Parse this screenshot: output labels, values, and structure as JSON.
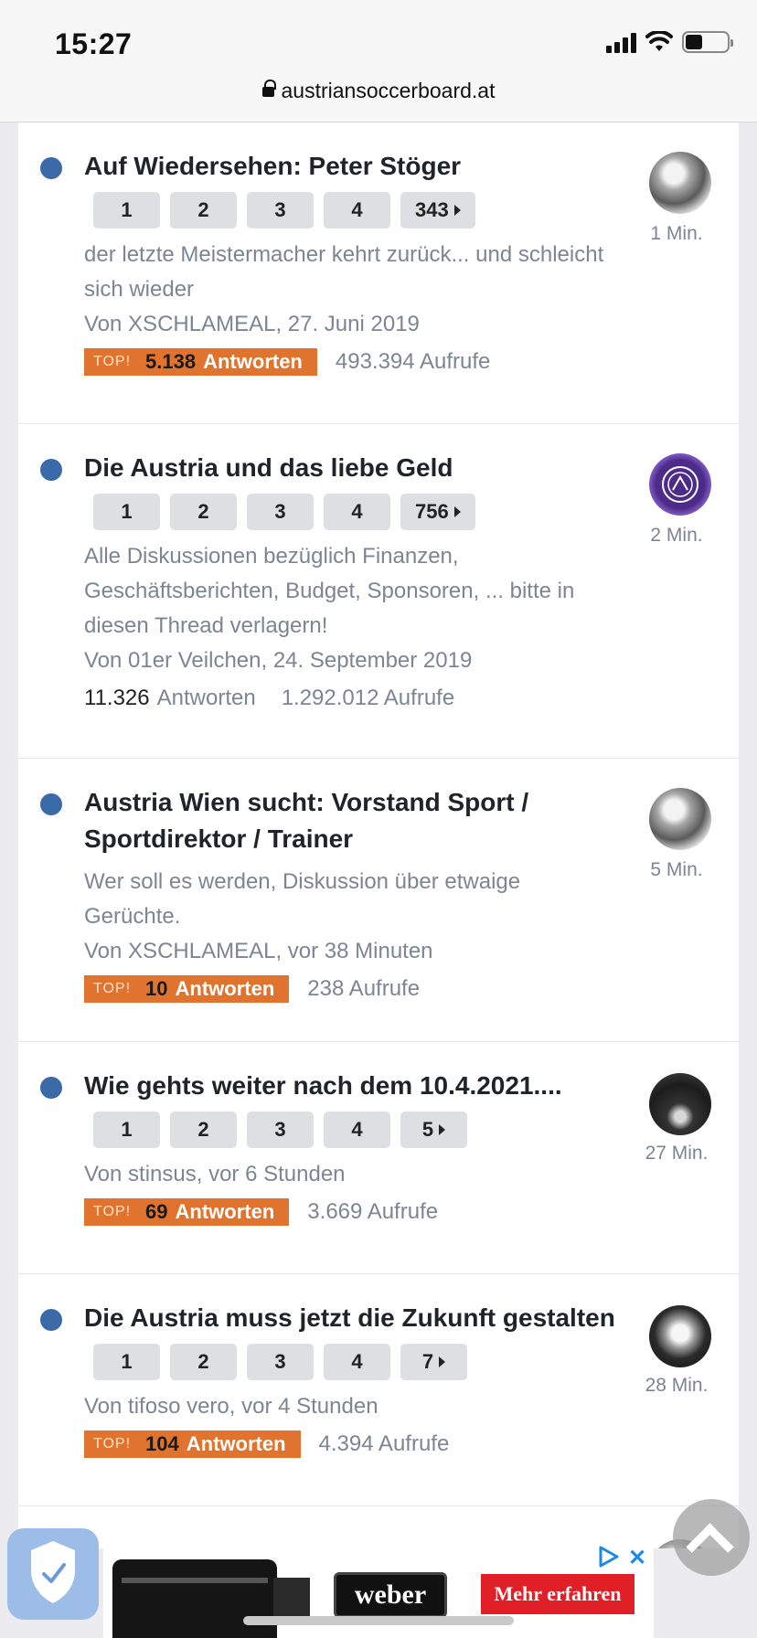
{
  "status_bar": {
    "time": "15:27"
  },
  "browser": {
    "url": "austriansoccerboard.at"
  },
  "topics": [
    {
      "title": "Auf Wiedersehen: Peter Stöger",
      "pages": [
        "1",
        "2",
        "3",
        "4",
        "343"
      ],
      "description": "der letzte Meistermacher kehrt zurück... und schleicht sich wieder",
      "author": "Von XSCHLAMEAL, 27. Juni 2019",
      "top": true,
      "top_tag": "TOP!",
      "replies": "5.138",
      "replies_label": "Antworten",
      "views": "493.394 Aufrufe",
      "time": "1 Min.",
      "avatar": "gray"
    },
    {
      "title": "Die Austria und das liebe Geld",
      "pages": [
        "1",
        "2",
        "3",
        "4",
        "756"
      ],
      "description": "Alle Diskussionen bezüglich Finanzen, Geschäftsberichten, Budget, Sponsoren, ... bitte in diesen Thread verlagern!",
      "author": "Von 01er Veilchen, 24. September 2019",
      "top": false,
      "replies": "11.326",
      "replies_label": "Antworten",
      "views": "1.292.012 Aufrufe",
      "time": "2 Min.",
      "avatar": "fak"
    },
    {
      "title": "Austria Wien sucht: Vorstand Sport / Sportdirektor / Trainer",
      "pages": [],
      "description": "Wer soll es werden, Diskussion über etwaige Gerüchte.",
      "author": "Von XSCHLAMEAL, vor 38 Minuten",
      "top": true,
      "top_tag": "TOP!",
      "replies": "10",
      "replies_label": "Antworten",
      "views": "238 Aufrufe",
      "time": "5 Min.",
      "avatar": "gray"
    },
    {
      "title": "Wie gehts weiter nach dem 10.4.2021....",
      "pages": [
        "1",
        "2",
        "3",
        "4",
        "5"
      ],
      "description": "",
      "author": "Von stinsus, vor 6 Stunden",
      "top": true,
      "top_tag": "TOP!",
      "replies": "69",
      "replies_label": "Antworten",
      "views": "3.669 Aufrufe",
      "time": "27 Min.",
      "avatar": "car"
    },
    {
      "title": "Die Austria muss jetzt die Zukunft gestalten",
      "pages": [
        "1",
        "2",
        "3",
        "4",
        "7"
      ],
      "description": "",
      "author": "Von tifoso vero, vor 4 Stunden",
      "top": true,
      "top_tag": "TOP!",
      "replies": "104",
      "replies_label": "Antworten",
      "views": "4.394 Aufrufe",
      "time": "28 Min.",
      "avatar": "face"
    }
  ],
  "ad": {
    "brand": "weber",
    "cta": "Mehr erfahren",
    "close": "✕"
  },
  "colors": {
    "accent": "#3b6aa8",
    "top_badge": "#e0732e",
    "ad_cta": "#e01f26"
  }
}
